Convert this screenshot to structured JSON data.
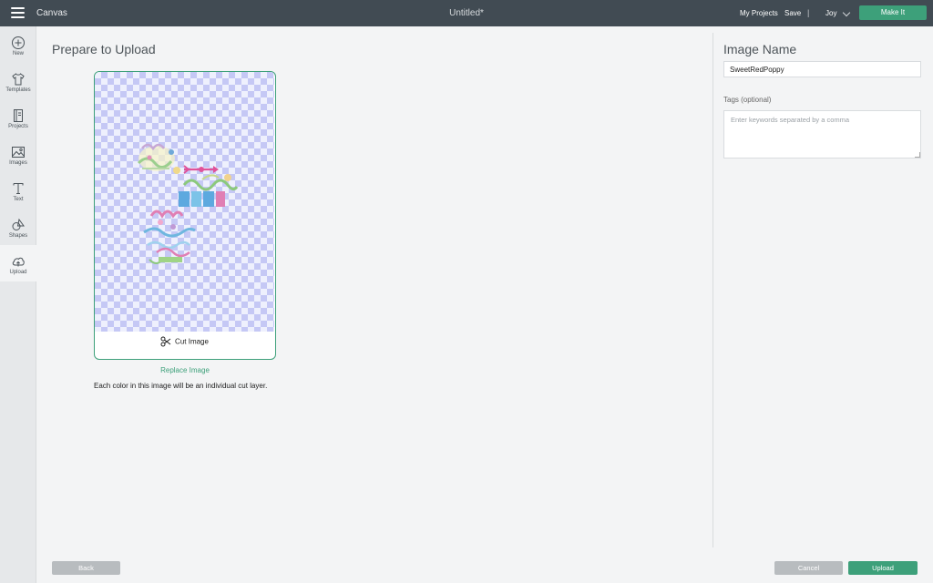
{
  "header": {
    "app_name": "Canvas",
    "document_title": "Untitled*",
    "my_projects": "My Projects",
    "save": "Save",
    "separator": "|",
    "user_name": "Joy",
    "make_it": "Make It"
  },
  "sidebar": {
    "items": [
      {
        "label": "New",
        "icon": "plus-circle-icon"
      },
      {
        "label": "Templates",
        "icon": "tshirt-icon"
      },
      {
        "label": "Projects",
        "icon": "book-icon"
      },
      {
        "label": "Images",
        "icon": "image-icon"
      },
      {
        "label": "Text",
        "icon": "text-icon"
      },
      {
        "label": "Shapes",
        "icon": "shapes-icon"
      },
      {
        "label": "Upload",
        "icon": "cloud-upload-icon",
        "active": true
      }
    ]
  },
  "main": {
    "title": "Prepare to Upload",
    "cut_label": "Cut Image",
    "replace_label": "Replace Image",
    "note": "Each color in this image will be an individual cut layer."
  },
  "image_panel": {
    "title": "Image Name",
    "name_value": "SweetRedPoppy",
    "tags_label": "Tags (optional)",
    "tags_placeholder": "Enter keywords separated by a comma"
  },
  "footer": {
    "back": "Back",
    "cancel": "Cancel",
    "upload": "Upload"
  },
  "colors": {
    "accent": "#3da07a",
    "header_bg": "#414b53",
    "checker": "#c5c8f5"
  }
}
